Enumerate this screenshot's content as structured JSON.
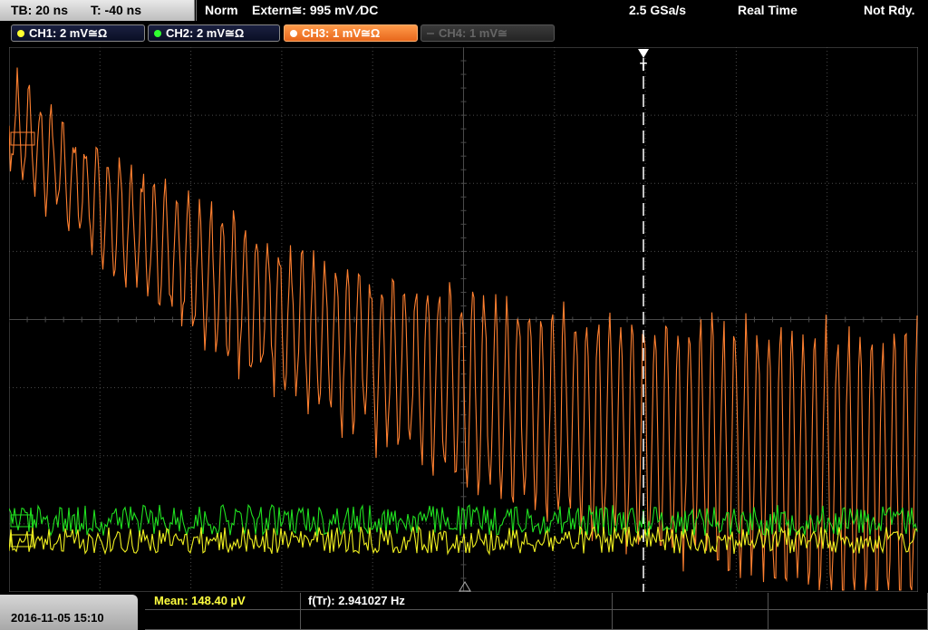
{
  "topbar": {
    "timebase": "TB: 20 ns",
    "trigger_time": "T: -40 ns",
    "trigger_mode": "Norm",
    "trigger_source": "Extern≅: 995 mV ⁄DC",
    "sample_rate": "2.5 GSa/s",
    "acq_mode": "Real Time",
    "status": "Not Rdy."
  },
  "channels": [
    {
      "label": "CH1: 2 mV≅Ω",
      "color": "#ffff30",
      "state": "on"
    },
    {
      "label": "CH2: 2 mV≅Ω",
      "color": "#30ff30",
      "state": "on"
    },
    {
      "label": "CH3: 1 mV≅Ω",
      "color": "#ff8c2a",
      "state": "selected"
    },
    {
      "label": "CH4: 1 mV≅",
      "color": "#666666",
      "state": "off"
    }
  ],
  "trigger_marker": "T",
  "footer": {
    "datetime": "2016-11-05 15:10",
    "mean": "Mean: 148.40 µV",
    "freq": "f(Tr): 2.941027 Hz"
  },
  "colors": {
    "ch1": "#f0f020",
    "ch2": "#20e020",
    "ch3": "#ff8030",
    "grid": "#4a4a4a",
    "background": "#000000"
  }
}
